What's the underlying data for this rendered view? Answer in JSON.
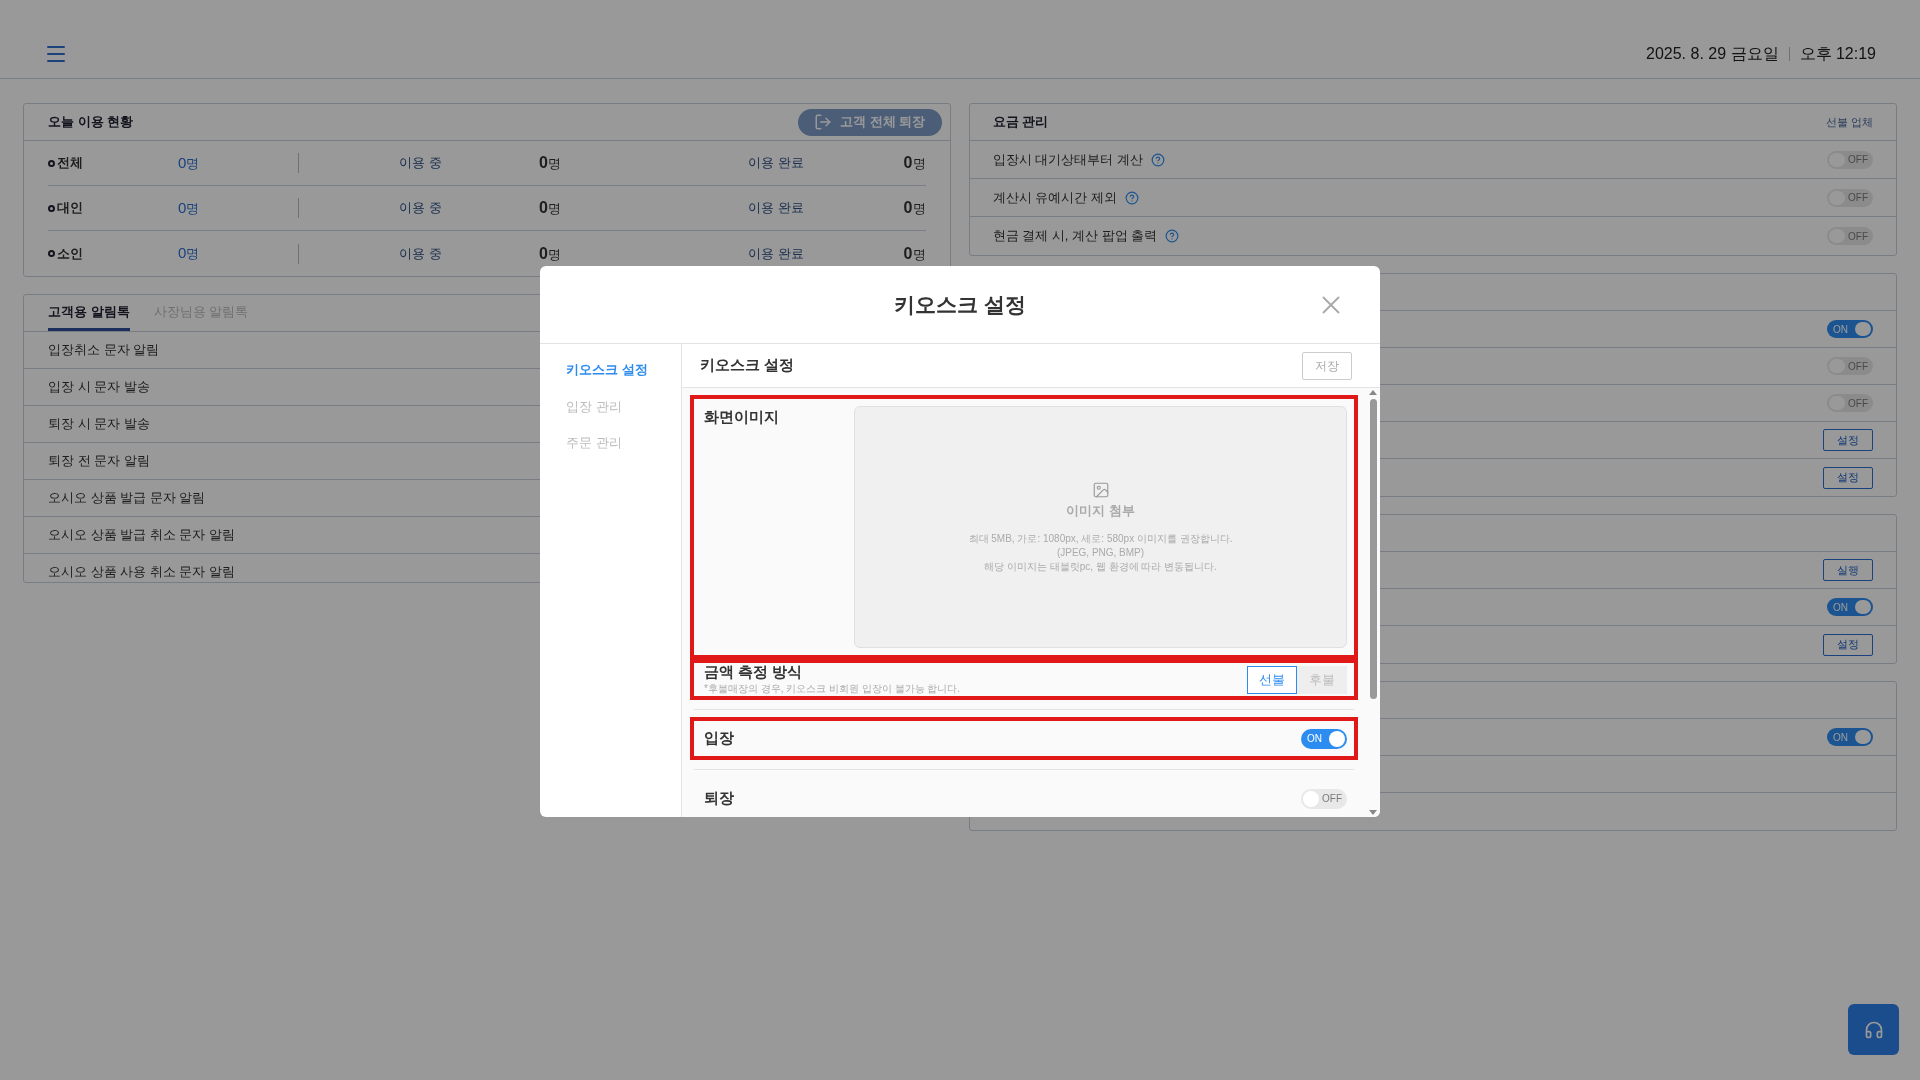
{
  "header": {
    "date": "2025. 8. 29 금요일",
    "time": "오후 12:19"
  },
  "usage": {
    "title": "오늘 이용 현황",
    "action": "고객 전체 퇴장",
    "rows": [
      {
        "label": "전체",
        "total": "0",
        "unit": "명",
        "in_use_label": "이용 중",
        "in_use": "0",
        "in_use_unit": "명",
        "done_label": "이용 완료",
        "done": "0",
        "done_unit": "명"
      },
      {
        "label": "대인",
        "total": "0",
        "unit": "명",
        "in_use_label": "이용 중",
        "in_use": "0",
        "in_use_unit": "명",
        "done_label": "이용 완료",
        "done": "0",
        "done_unit": "명"
      },
      {
        "label": "소인",
        "total": "0",
        "unit": "명",
        "in_use_label": "이용 중",
        "in_use": "0",
        "in_use_unit": "명",
        "done_label": "이용 완료",
        "done": "0",
        "done_unit": "명"
      }
    ]
  },
  "alerts": {
    "tabs": [
      {
        "label": "고객용 알림톡",
        "selected": true
      },
      {
        "label": "사장님용 알림톡",
        "selected": false
      }
    ],
    "rows": [
      "입장취소 문자 알림",
      "입장 시 문자 발송",
      "퇴장 시 문자 발송",
      "퇴장 전 문자 알림",
      "오시오 상품 발급 문자 알림",
      "오시오 상품 발급 취소 문자 알림",
      "오시오 상품 사용 취소 문자 알림"
    ]
  },
  "fees": {
    "title": "요금 관리",
    "subtitle": "선불 업체",
    "rows": [
      {
        "label": "입장시 대기상태부터 계산",
        "on": false,
        "toggle_label": "OFF"
      },
      {
        "label": "계산시 유예시간 제외",
        "on": false,
        "toggle_label": "OFF"
      },
      {
        "label": "현금 결제 시, 계산 팝업 출력",
        "on": false,
        "toggle_label": "OFF"
      }
    ]
  },
  "panels": [
    {
      "rows": [
        {
          "kind": "toggle",
          "on": true,
          "label": "ON"
        },
        {
          "kind": "toggle",
          "on": false,
          "label": "OFF"
        },
        {
          "kind": "toggle",
          "on": false,
          "label": "OFF"
        },
        {
          "kind": "button",
          "label": "설정"
        },
        {
          "kind": "button",
          "label": "설정"
        }
      ]
    },
    {
      "rows": [
        {
          "kind": "button",
          "label": "실행"
        },
        {
          "kind": "toggle",
          "on": true,
          "label": "ON"
        },
        {
          "kind": "button",
          "label": "설정"
        }
      ]
    },
    {
      "rows": [
        {
          "kind": "toggle",
          "on": true,
          "label": "ON"
        },
        {
          "kind": "empty"
        },
        {
          "kind": "empty"
        }
      ]
    }
  ],
  "modal": {
    "title": "키오스크 설정",
    "nav": [
      {
        "label": "키오스크 설정",
        "selected": true
      },
      {
        "label": "입장 관리",
        "selected": false
      },
      {
        "label": "주문 관리",
        "selected": false
      }
    ],
    "section_title": "키오스크 설정",
    "save": "저장",
    "image": {
      "label": "화면이미지",
      "highlighted": true,
      "upload_title": "이미지 첨부",
      "hints": [
        "최대 5MB, 가로: 1080px, 세로: 580px 이미지를 권장합니다.",
        "(JPEG, PNG, BMP)",
        "해당 이미지는 태블릿pc, 웹 환경에 따라 변동됩니다."
      ]
    },
    "payment": {
      "label": "금액 측정 방식",
      "highlighted": true,
      "note": "*후불매장의 경우, 키오스크 비회원 입장이 불가능 합니다.",
      "options": [
        {
          "label": "선불",
          "selected": true
        },
        {
          "label": "후불",
          "selected": false
        }
      ]
    },
    "switches": [
      {
        "label": "입장",
        "highlighted": true,
        "on": true,
        "toggle_label": "ON"
      },
      {
        "label": "퇴장",
        "highlighted": false,
        "on": false,
        "toggle_label": "OFF"
      }
    ]
  }
}
